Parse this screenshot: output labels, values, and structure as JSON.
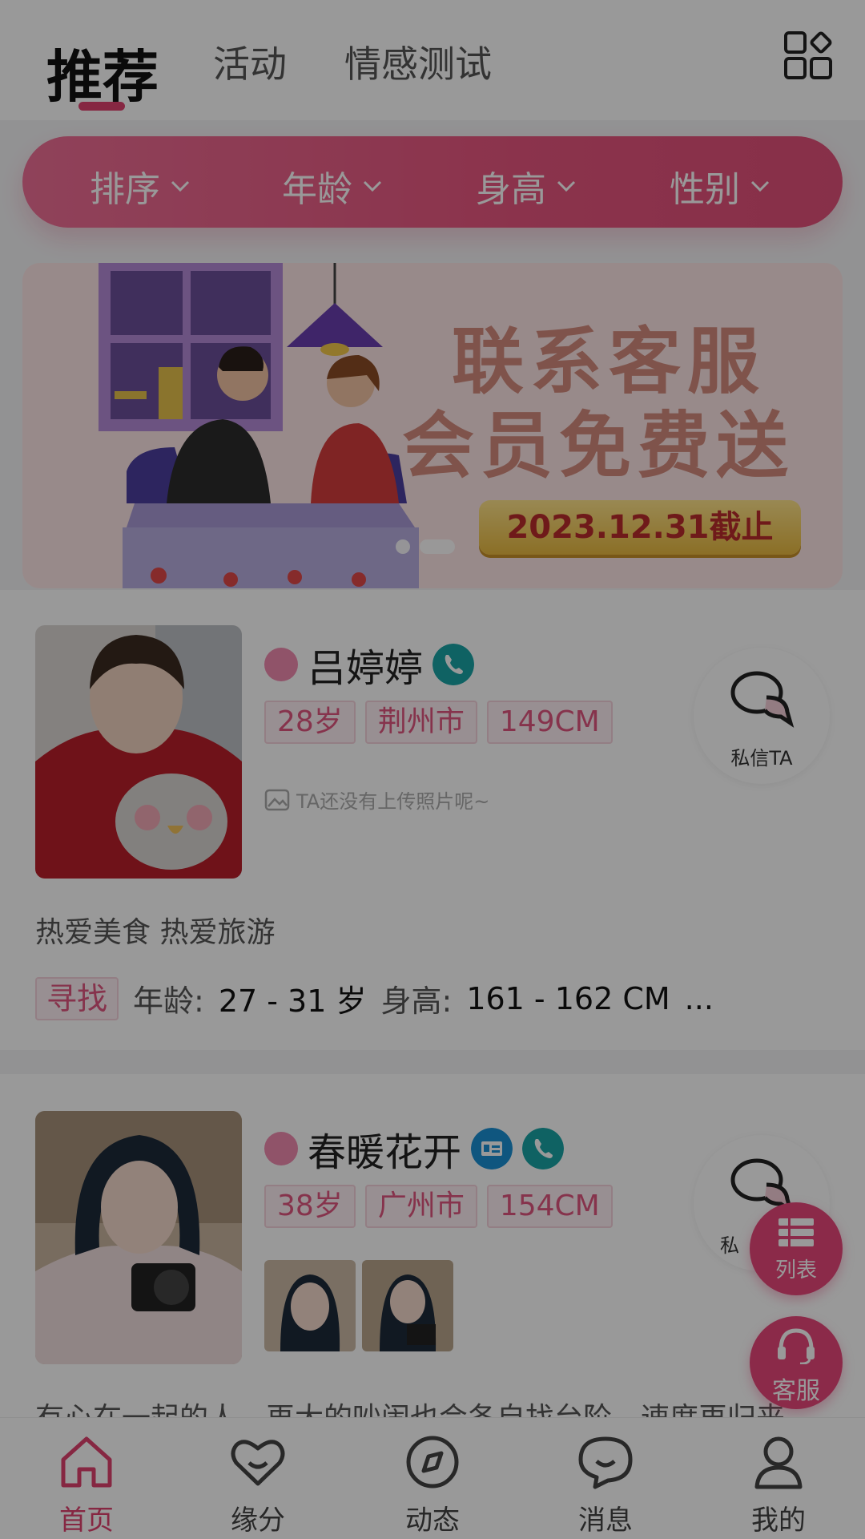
{
  "tabs": [
    {
      "label": "推荐"
    },
    {
      "label": "活动"
    },
    {
      "label": "情感测试"
    }
  ],
  "filters": [
    {
      "label": "排序"
    },
    {
      "label": "年龄"
    },
    {
      "label": "身高"
    },
    {
      "label": "性别"
    }
  ],
  "banner": {
    "line1": "联系客服",
    "line2": "会员免费送",
    "deadline": "2023.12.31截止"
  },
  "profiles": [
    {
      "name": "吕婷婷",
      "tags": [
        "28岁",
        "荆州市",
        "149CM"
      ],
      "no_photo_text": "TA还没有上传照片呢~",
      "message_label": "私信TA",
      "bio": "热爱美食 热爱旅游",
      "seek_label": "寻找",
      "age_label": "年龄:",
      "age_range": "27 - 31 岁",
      "height_label": "身高:",
      "height_range": "161 - 162 CM",
      "more": "..."
    },
    {
      "name": "春暖花开",
      "tags": [
        "38岁",
        "广州市",
        "154CM"
      ],
      "message_label": "私",
      "bio": "有心在一起的人，再大的吵闹也会各自找台阶，速度再归来"
    }
  ],
  "fabs": {
    "list_label": "列表",
    "service_label": "客服"
  },
  "nav": [
    {
      "label": "首页"
    },
    {
      "label": "缘分"
    },
    {
      "label": "动态"
    },
    {
      "label": "消息"
    },
    {
      "label": "我的"
    }
  ],
  "colors": {
    "accent": "#e0416f",
    "teal": "#19a3a6",
    "overlay": "rgba(0,0,0,0.40)"
  }
}
